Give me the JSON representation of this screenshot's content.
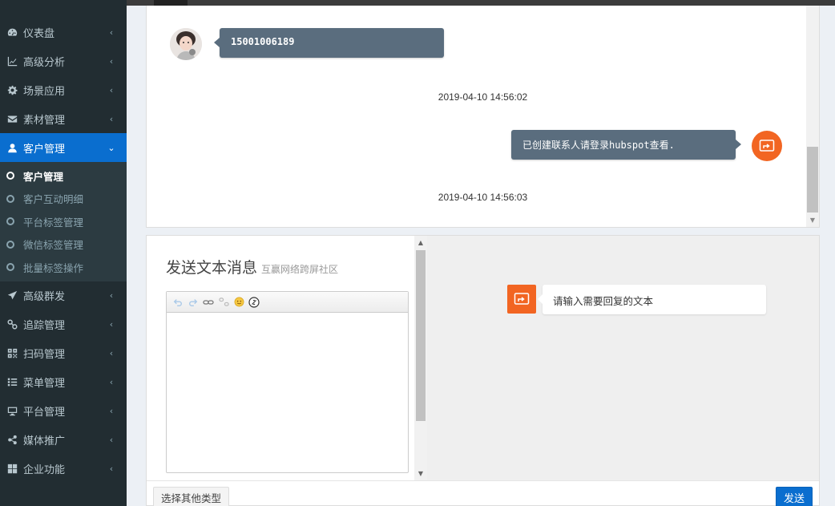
{
  "sidebar": {
    "items": [
      {
        "label": "仪表盘",
        "icon": "dashboard-icon",
        "chevron": "‹"
      },
      {
        "label": "高级分析",
        "icon": "line-chart-icon",
        "chevron": "‹"
      },
      {
        "label": "场景应用",
        "icon": "gear-icon",
        "chevron": "‹"
      },
      {
        "label": "素材管理",
        "icon": "envelope-icon",
        "chevron": "‹"
      },
      {
        "label": "客户管理",
        "icon": "user-icon",
        "chevron": "⌄"
      },
      {
        "label": "高级群发",
        "icon": "paper-plane-icon",
        "chevron": "‹"
      },
      {
        "label": "追踪管理",
        "icon": "link-icon",
        "chevron": "‹"
      },
      {
        "label": "扫码管理",
        "icon": "qrcode-icon",
        "chevron": "‹"
      },
      {
        "label": "菜单管理",
        "icon": "list-icon",
        "chevron": "‹"
      },
      {
        "label": "平台管理",
        "icon": "desktop-icon",
        "chevron": "‹"
      },
      {
        "label": "媒体推广",
        "icon": "share-icon",
        "chevron": "‹"
      },
      {
        "label": "企业功能",
        "icon": "grid-icon",
        "chevron": "‹"
      }
    ],
    "submenu": [
      {
        "label": "客户管理"
      },
      {
        "label": "客户互动明细"
      },
      {
        "label": "平台标签管理"
      },
      {
        "label": "微信标签管理"
      },
      {
        "label": "批量标签操作"
      }
    ]
  },
  "chat": {
    "messages": [
      {
        "from": "user",
        "text": "15001006189"
      },
      {
        "timestamp": "2019-04-10 14:56:02"
      },
      {
        "from": "bot",
        "text": "已创建联系人请登录hubspot查看."
      },
      {
        "timestamp": "2019-04-10 14:56:03"
      }
    ]
  },
  "composer": {
    "title": "发送文本消息",
    "subtitle": "互赢网络跨屏社区",
    "toolbar_icons": [
      "undo-icon",
      "redo-icon",
      "link-icon",
      "unlink-icon",
      "emoji-icon",
      "anchor-icon"
    ],
    "preview_text": "请输入需要回复的文本",
    "other_type_label": "选择其他类型",
    "send_label": "发送"
  },
  "colors": {
    "sidebar_bg": "#222d32",
    "active_blue": "#0a6ecf",
    "bubble_bg": "#5a6d7e",
    "bot_orange": "#f26522"
  }
}
